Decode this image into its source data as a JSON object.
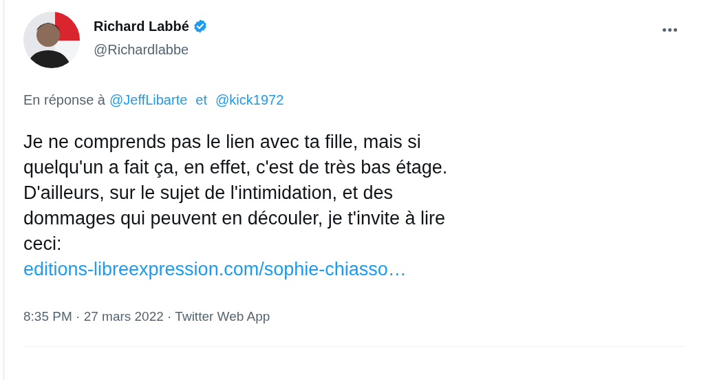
{
  "author": {
    "name": "Richard Labbé",
    "verified": true,
    "handle": "@Richardlabbe"
  },
  "reply_to": {
    "prefix": "En réponse à",
    "mentions": [
      "@JeffLibarte",
      "@kick1972"
    ],
    "joiner": "et"
  },
  "body": "Je ne comprends pas le lien avec ta fille, mais si\nquelqu'un a fait ça, en effet, c'est de très bas étage.\nD'ailleurs, sur le sujet de l'intimidation, et des\ndommages qui peuvent en découler, je t'invite à lire\nceci:",
  "link": "editions-libreexpression.com/sophie-chiasso…",
  "meta": "8:35 PM · 27 mars 2022 · Twitter Web App"
}
